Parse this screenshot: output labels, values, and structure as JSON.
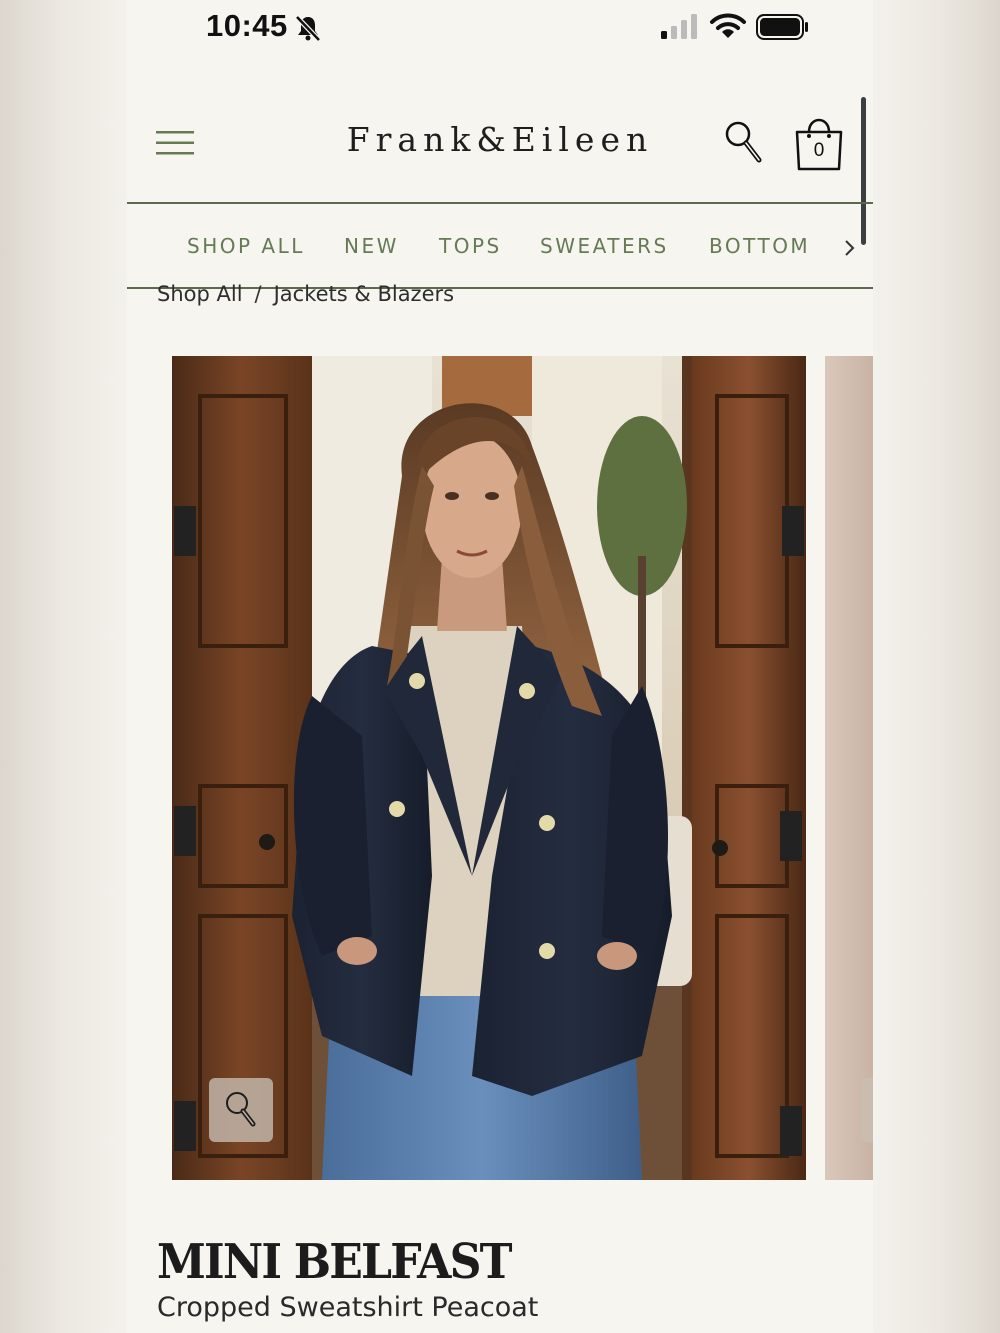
{
  "status_bar": {
    "time": "10:45",
    "icons": [
      "bell-slash-icon",
      "cellular-signal-icon",
      "wifi-icon",
      "battery-icon"
    ]
  },
  "header": {
    "brand": "Frank&Eileen",
    "cart_count": "0",
    "icons": [
      "menu-icon",
      "search-icon",
      "shopping-bag-icon"
    ]
  },
  "nav": {
    "items": [
      {
        "label": "SHOP ALL"
      },
      {
        "label": "NEW"
      },
      {
        "label": "TOPS"
      },
      {
        "label": "SWEATERS"
      },
      {
        "label": "BOTTOM"
      }
    ],
    "more_icon": "chevron-right-icon"
  },
  "breadcrumb": {
    "items": [
      {
        "label": "Shop All"
      },
      {
        "label": "Jackets & Blazers"
      }
    ],
    "separator": "/"
  },
  "product": {
    "name": "MINI BELFAST",
    "subtitle": "Cropped Sweatshirt Peacoat",
    "image_alt": "Woman wearing navy double-breasted cropped sweatshirt peacoat with cream sweater and blue jeans, standing in a doorway",
    "zoom_icon": "magnifier-icon"
  },
  "colors": {
    "accent_green": "#667a56",
    "divider": "#5b6a4f",
    "background": "#f6f5f0",
    "text": "#1c1c1c"
  }
}
